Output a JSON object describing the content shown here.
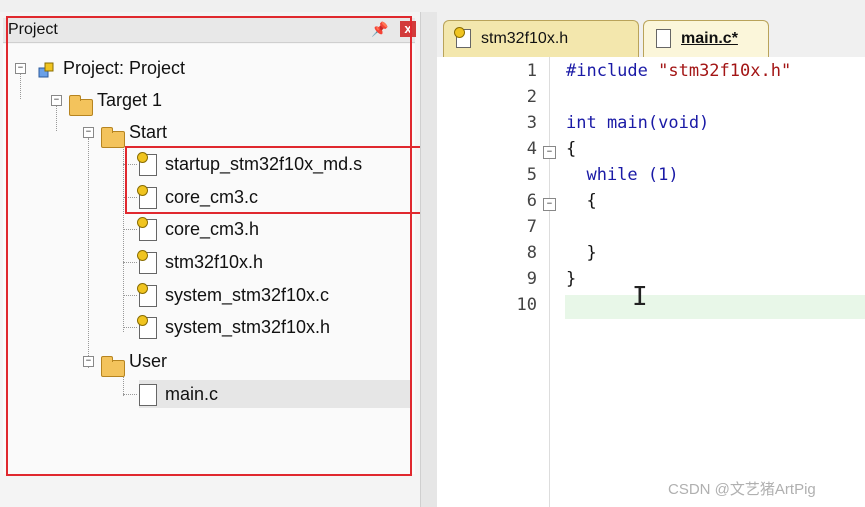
{
  "project_panel": {
    "title": "Project",
    "pin_glyph": "ᴘ",
    "close_glyph": "x",
    "tree": {
      "root": "Project: Project",
      "target": "Target 1",
      "groups": [
        {
          "name": "Start",
          "files": [
            "startup_stm32f10x_md.s",
            "core_cm3.c",
            "core_cm3.h",
            "stm32f10x.h",
            "system_stm32f10x.c",
            "system_stm32f10x.h"
          ]
        },
        {
          "name": "User",
          "files": [
            "main.c"
          ]
        }
      ]
    }
  },
  "editor": {
    "tabs": [
      {
        "label": "stm32f10x.h",
        "active": false
      },
      {
        "label": "main.c*",
        "active": true
      }
    ],
    "line_numbers": [
      "1",
      "2",
      "3",
      "4",
      "5",
      "6",
      "7",
      "8",
      "9",
      "10"
    ],
    "lines": [
      {
        "t1": "#include ",
        "t2": "\"stm32f10x.h\""
      },
      {
        "t1": ""
      },
      {
        "t1": "int main(void)"
      },
      {
        "t1": "{"
      },
      {
        "t1": "  while (1)"
      },
      {
        "t1": "  {"
      },
      {
        "t1": ""
      },
      {
        "t1": "  }"
      },
      {
        "t1": "}"
      },
      {
        "t1": ""
      }
    ]
  },
  "watermark": "CSDN @文艺猪ArtPig",
  "colors": {
    "highlight_box": "#e0282e",
    "tab_bg": "#f3e7ad",
    "current_line": "#e8f7e8"
  }
}
